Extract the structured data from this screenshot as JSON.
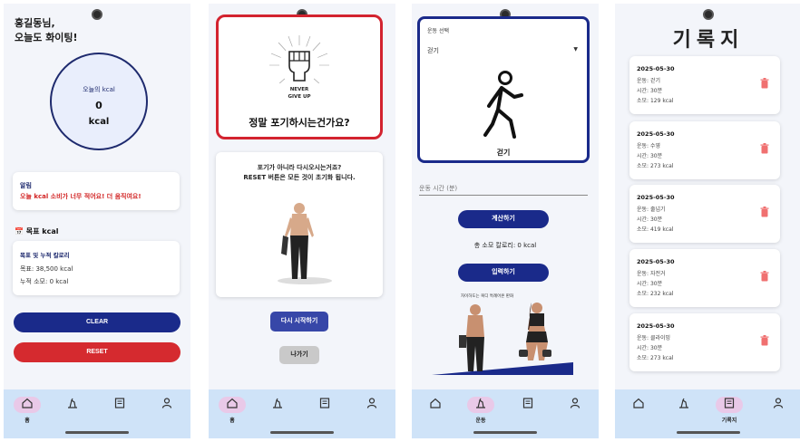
{
  "screen1": {
    "greeting": [
      "홍길동님,",
      "오늘도 화이팅!"
    ],
    "kcal_label": "오늘의 kcal",
    "kcal_value": "0",
    "kcal_unit": "kcal",
    "alert_title": "알림",
    "alert_message": "오늘 kcal 소비가 너무 적어요! 더 움직여요!",
    "goal_header": "📅 목표 kcal",
    "goal_card_title": "목표 및 누적 칼로리",
    "goal_line": "목표: 38,500 kcal",
    "cumulative_line": "누적 소모: 0 kcal",
    "clear_label": "CLEAR",
    "reset_label": "RESET",
    "nav_home_label": "홈"
  },
  "screen2": {
    "badge_text": "NEVER GIVE UP",
    "quit_title": "정말 포기하시는건가요?",
    "reset_message": [
      "포기가 아니라 다시오시는거죠?",
      "RESET 버튼은 모든 것이 초기화 됩니다."
    ],
    "restart_label": "다시 시작하기",
    "exit_label": "나가기",
    "nav_home_label": "홈"
  },
  "screen3": {
    "select_label": "운동 선택",
    "select_value": "걷기",
    "exercise_label": "걷기",
    "time_placeholder": "운동 시간 (분)",
    "calc_label": "계산하기",
    "total_kcal": "총 소모 칼로리: 0 kcal",
    "submit_label": "입력하기",
    "recommend_text": "자이하도는 복디 특례어온 판화",
    "nav_exercise_label": "운동"
  },
  "screen4": {
    "title": "기록지",
    "records": [
      {
        "date": "2025-05-30",
        "exercise": "운동: 걷기",
        "time": "시간: 30분",
        "burn": "소모: 129 kcal"
      },
      {
        "date": "2025-05-30",
        "exercise": "운동: 수영",
        "time": "시간: 30분",
        "burn": "소모: 273 kcal"
      },
      {
        "date": "2025-05-30",
        "exercise": "운동: 줄넘기",
        "time": "시간: 30분",
        "burn": "소모: 419 kcal"
      },
      {
        "date": "2025-05-30",
        "exercise": "운동: 자전거",
        "time": "시간: 30분",
        "burn": "소모: 232 kcal"
      },
      {
        "date": "2025-05-30",
        "exercise": "운동: 클라이밍",
        "time": "시간: 30분",
        "burn": "소모: 273 kcal"
      }
    ],
    "nav_record_label": "기록지"
  },
  "colors": {
    "navy": "#1a2a8a",
    "red": "#d52a2f",
    "trash": "#f07070",
    "nav_bg": "#cfe3f8",
    "active_pill": "#e9c9e8"
  },
  "icons": [
    "home-icon",
    "exercise-icon",
    "record-icon",
    "profile-icon",
    "trash-icon",
    "walking-icon",
    "fist-icon"
  ]
}
